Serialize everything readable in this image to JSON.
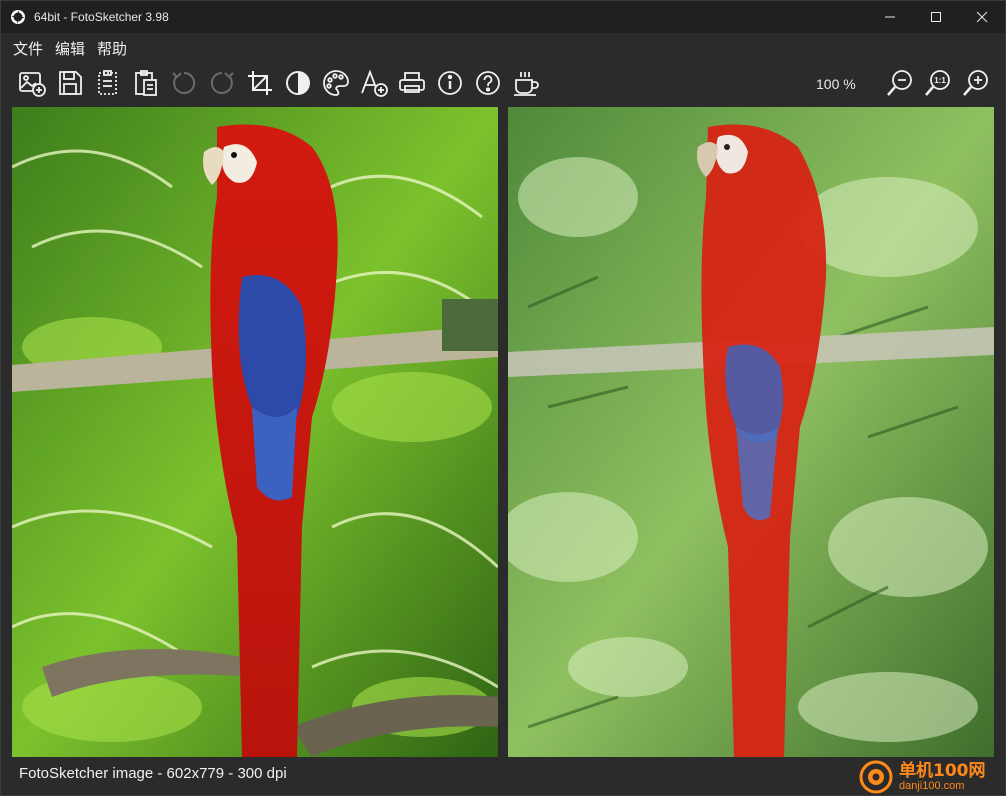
{
  "window": {
    "title": "64bit - FotoSketcher 3.98"
  },
  "menu": {
    "items": [
      {
        "label": "文件"
      },
      {
        "label": "编辑"
      },
      {
        "label": "帮助"
      }
    ]
  },
  "toolbar": {
    "buttons": [
      {
        "icon": "open-image-icon",
        "enabled": true
      },
      {
        "icon": "save-icon",
        "enabled": true
      },
      {
        "icon": "copy-icon",
        "enabled": true
      },
      {
        "icon": "paste-icon",
        "enabled": true
      },
      {
        "icon": "undo-icon",
        "enabled": false
      },
      {
        "icon": "redo-icon",
        "enabled": false
      },
      {
        "icon": "crop-icon",
        "enabled": true
      },
      {
        "icon": "contrast-icon",
        "enabled": true
      },
      {
        "icon": "palette-icon",
        "enabled": true
      },
      {
        "icon": "add-text-icon",
        "enabled": true
      },
      {
        "icon": "print-icon",
        "enabled": true
      },
      {
        "icon": "info-icon",
        "enabled": true
      },
      {
        "icon": "help-icon",
        "enabled": true
      },
      {
        "icon": "coffee-icon",
        "enabled": true
      }
    ],
    "zoom_level": "100 %",
    "zoom_buttons": [
      {
        "icon": "zoom-out-icon"
      },
      {
        "icon": "zoom-actual-icon",
        "label": "1:1"
      },
      {
        "icon": "zoom-in-icon"
      }
    ]
  },
  "panes": {
    "left": {
      "content": "original-photo"
    },
    "right": {
      "content": "painted-result"
    }
  },
  "status": {
    "text": "FotoSketcher image - 602x779 - 300 dpi"
  },
  "watermark": {
    "main": "单机100网",
    "sub": "danji100.com"
  },
  "colors": {
    "background": "#2b2b2b",
    "titlebar": "#202020",
    "text": "#f0f0f0",
    "watermark": "#ff8a1a"
  }
}
